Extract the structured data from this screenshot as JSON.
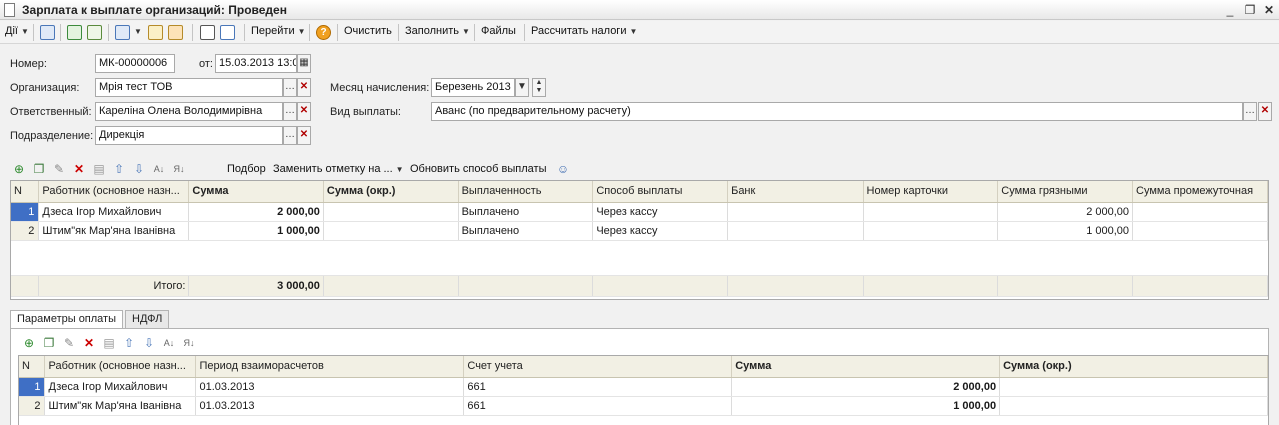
{
  "window": {
    "title": "Зарплата к выплате организаций: Проведен"
  },
  "toolbar": {
    "actions": "Дії",
    "goto": "Перейти",
    "help": "?",
    "clear": "Очистить",
    "fill": "Заполнить",
    "files": "Файлы",
    "calc_taxes": "Рассчитать налоги"
  },
  "form": {
    "number_label": "Номер:",
    "number_value": "МК-00000006",
    "date_label": "от:",
    "date_value": "15.03.2013 13:0",
    "org_label": "Организация:",
    "org_value": "Мрія тест ТОВ",
    "resp_label": "Ответственный:",
    "resp_value": "Кареліна Олена Володимирівна",
    "dept_label": "Подразделение:",
    "dept_value": "Дирекція",
    "month_label": "Месяц начисления:",
    "month_value": "Березень 2013",
    "paytype_label": "Вид выплаты:",
    "paytype_value": "Аванс (по предварительному расчету)"
  },
  "grid_toolbar": {
    "pick": "Подбор",
    "replace_mark": "Заменить отметку на ...",
    "update_method": "Обновить способ выплаты"
  },
  "main_table": {
    "columns": [
      "N",
      "Работник (основное назн...",
      "Сумма",
      "Сумма (окр.)",
      "Выплаченность",
      "Способ выплаты",
      "Банк",
      "Номер карточки",
      "Сумма грязными",
      "Сумма промежуточная"
    ],
    "rows": [
      {
        "n": "1",
        "worker": "Дзеса Ігор Михайлович",
        "sum": "2 000,00",
        "sum_rounded": "",
        "paid": "Выплачено",
        "method": "Через кассу",
        "bank": "",
        "card": "",
        "gross": "2 000,00",
        "interim": ""
      },
      {
        "n": "2",
        "worker": "Штим\"як Мар'яна Іванівна",
        "sum": "1 000,00",
        "sum_rounded": "",
        "paid": "Выплачено",
        "method": "Через кассу",
        "bank": "",
        "card": "",
        "gross": "1 000,00",
        "interim": ""
      }
    ],
    "total_label": "Итого:",
    "total_sum": "3 000,00"
  },
  "tabs": [
    "Параметры оплаты",
    "НДФЛ"
  ],
  "params_table": {
    "columns": [
      "N",
      "Работник (основное назн...",
      "Период взаиморасчетов",
      "Счет учета",
      "Сумма",
      "Сумма (окр.)"
    ],
    "rows": [
      {
        "n": "1",
        "worker": "Дзеса Ігор Михайлович",
        "period": "01.03.2013",
        "account": "661",
        "sum": "2 000,00",
        "sum_rounded": ""
      },
      {
        "n": "2",
        "worker": "Штим\"як Мар'яна Іванівна",
        "period": "01.03.2013",
        "account": "661",
        "sum": "1 000,00",
        "sum_rounded": ""
      }
    ]
  },
  "colors": {
    "accent": "#3f6fc5",
    "header_bg": "#f2f0e4",
    "error_x": "#b00000"
  }
}
